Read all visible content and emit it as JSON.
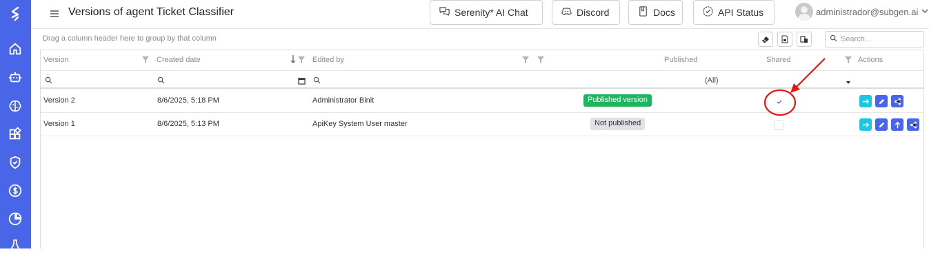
{
  "header": {
    "title": "Versions of agent Ticket Classifier",
    "buttons": [
      {
        "label": "Serenity* AI Chat",
        "icon": "chat-icon"
      },
      {
        "label": "Discord",
        "icon": "discord-icon"
      },
      {
        "label": "Docs",
        "icon": "book-icon"
      },
      {
        "label": "API Status",
        "icon": "badge-check-icon"
      }
    ],
    "user": "administrador@subgen.ai"
  },
  "sidebar": {
    "items": [
      "home-icon",
      "robot-icon",
      "brain-icon",
      "apps-icon",
      "shield-icon",
      "dollar-icon",
      "pie-chart-icon",
      "flask-icon"
    ]
  },
  "grid": {
    "group_hint": "Drag a column header here to group by that column",
    "search_placeholder": "Search...",
    "columns": [
      "Version",
      "Created date",
      "Edited by",
      "Published",
      "Shared",
      "Actions"
    ],
    "published_filter": "(All)",
    "rows": [
      {
        "version": "Version 2",
        "created": "8/6/2025, 5:18 PM",
        "edited_by": "Administrator Binit",
        "published": "Published version",
        "is_published": true,
        "shared": true
      },
      {
        "version": "Version 1",
        "created": "8/6/2025, 5:13 PM",
        "edited_by": "ApiKey System User master",
        "published": "Not published",
        "is_published": false,
        "shared": false
      }
    ]
  },
  "colors": {
    "sidebar": "#4a66e8",
    "published": "#1fb45f",
    "action_go": "#1ec7e0",
    "action_blue": "#4a66e8",
    "annotation": "#e81515"
  }
}
